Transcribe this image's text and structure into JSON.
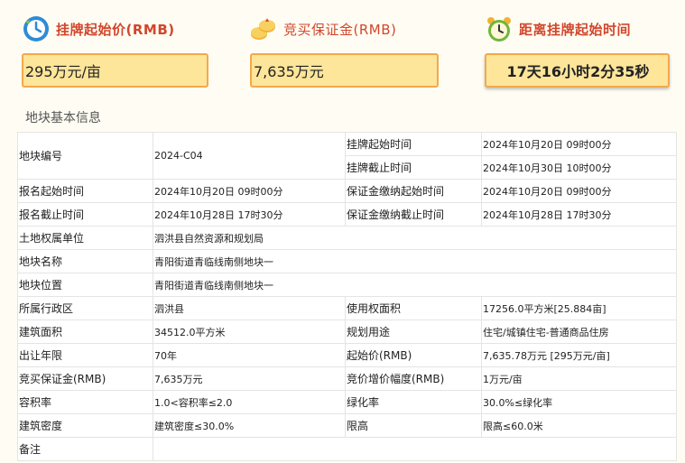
{
  "summary": {
    "start_price_label": "挂牌起始价(RMB)",
    "start_price_value": "295万元/亩",
    "deposit_label": "竞买保证金(RMB)",
    "deposit_value": "7,635万元",
    "countdown_label": "距离挂牌起始时间",
    "countdown_value": "17天16小时2分35秒"
  },
  "section_title": "地块基本信息",
  "table": {
    "parcel_no_label": "地块编号",
    "parcel_no": "2024-C04",
    "listing_start_label": "挂牌起始时间",
    "listing_start": "2024年10月20日 09时00分",
    "listing_end_label": "挂牌截止时间",
    "listing_end": "2024年10月30日 10时00分",
    "reg_start_label": "报名起始时间",
    "reg_start": "2024年10月20日 09时00分",
    "deposit_start_label": "保证金缴纳起始时间",
    "deposit_start": "2024年10月20日 09时00分",
    "reg_end_label": "报名截止时间",
    "reg_end": "2024年10月28日 17时30分",
    "deposit_end_label": "保证金缴纳截止时间",
    "deposit_end": "2024年10月28日 17时30分",
    "owner_label": "土地权属单位",
    "owner": "泗洪县自然资源和规划局",
    "name_label": "地块名称",
    "name": "青阳街道青临线南侧地块一",
    "location_label": "地块位置",
    "location": "青阳街道青临线南侧地块一",
    "district_label": "所属行政区",
    "district": "泗洪县",
    "area_label": "使用权面积",
    "area": "17256.0平方米[25.884亩]",
    "building_area_label": "建筑面积",
    "building_area": "34512.0平方米",
    "usage_label": "规划用途",
    "usage": "住宅/城镇住宅-普通商品住房",
    "term_label": "出让年限",
    "term": "70年",
    "start_price_label": "起始价(RMB)",
    "start_price": "7,635.78万元 [295万元/亩]",
    "deposit_label": "竞买保证金(RMB)",
    "deposit": "7,635万元",
    "increment_label": "竞价增价幅度(RMB)",
    "increment": "1万元/亩",
    "far_label": "容积率",
    "far": "1.0<容积率≤2.0",
    "green_label": "绿化率",
    "green": "30.0%≤绿化率",
    "density_label": "建筑密度",
    "density": "建筑密度≤30.0%",
    "height_label": "限高",
    "height": "限高≤60.0米",
    "remarks_label": "备注",
    "remarks": ""
  }
}
